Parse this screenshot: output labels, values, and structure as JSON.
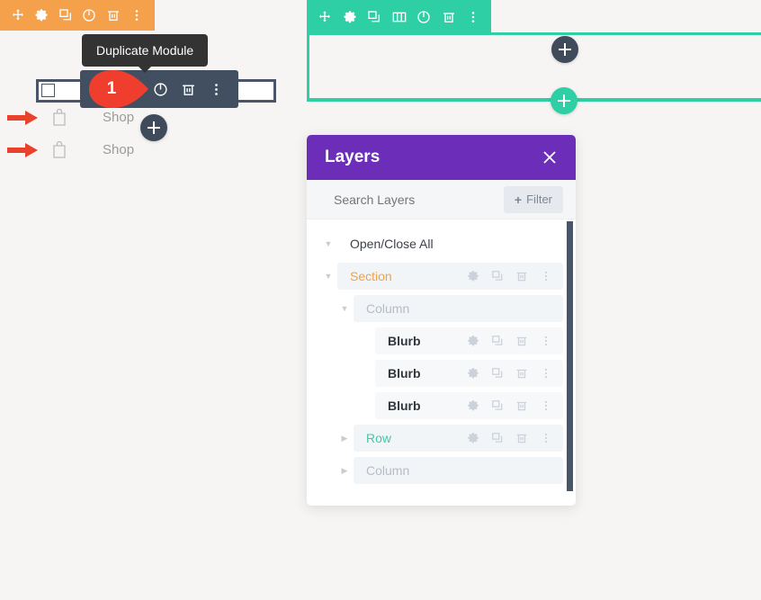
{
  "colors": {
    "canvas": "#f7f5f3",
    "module_toolbar_orange": "#f5a04a",
    "section_toolbar_green": "#2ecfa5",
    "hover_toolbar_dark": "#424f61",
    "tooltip_dark": "#333333",
    "marker_red": "#ef3d2e",
    "layers_header_purple": "#6c2eb9",
    "section_label_orange": "#f0a14a",
    "row_label_green": "#41c9a8",
    "arrow_red": "#e8412c"
  },
  "module_toolbar": {
    "name": "module-settings-toolbar",
    "buttons": [
      {
        "icon": "move-icon",
        "label": "Move"
      },
      {
        "icon": "gear-icon",
        "label": "Settings"
      },
      {
        "icon": "duplicate-icon",
        "label": "Duplicate"
      },
      {
        "icon": "power-icon",
        "label": "Disable"
      },
      {
        "icon": "trash-icon",
        "label": "Delete"
      },
      {
        "icon": "vertical-dots-icon",
        "label": "More Options"
      }
    ]
  },
  "section_toolbar": {
    "name": "section-settings-toolbar",
    "buttons": [
      {
        "icon": "move-icon",
        "label": "Move Section"
      },
      {
        "icon": "gear-icon",
        "label": "Section Settings"
      },
      {
        "icon": "duplicate-icon",
        "label": "Duplicate Section"
      },
      {
        "icon": "columns-icon",
        "label": "Change Column Structure"
      },
      {
        "icon": "power-icon",
        "label": "Disable Section"
      },
      {
        "icon": "trash-icon",
        "label": "Delete Section"
      },
      {
        "icon": "vertical-dots-icon",
        "label": "More Section Options"
      }
    ]
  },
  "hover_toolbar": {
    "name": "module-hover-toolbar",
    "buttons": [
      {
        "icon": "duplicate-icon",
        "label": "Duplicate Module"
      },
      {
        "icon": "power-icon",
        "label": "Disable Module"
      },
      {
        "icon": "trash-icon",
        "label": "Delete Module"
      },
      {
        "icon": "vertical-dots-icon",
        "label": "More Module Options"
      }
    ]
  },
  "tooltip": {
    "text": "Duplicate Module"
  },
  "marker": {
    "number": "1"
  },
  "annotations": [
    {
      "arrow": "arrow-right-icon",
      "icon": "shopping-bag-icon",
      "label": "Shop"
    },
    {
      "arrow": "arrow-right-icon",
      "icon": "shopping-bag-icon",
      "label": "Shop"
    }
  ],
  "add_buttons": [
    {
      "name": "add-module-button",
      "glyph": "+",
      "style": "dark"
    },
    {
      "name": "add-row-button",
      "glyph": "+",
      "style": "dark"
    },
    {
      "name": "add-section-button",
      "glyph": "+",
      "style": "green"
    }
  ],
  "layers_panel": {
    "title": "Layers",
    "close_icon": "close-icon",
    "search": {
      "placeholder": "Search Layers",
      "value": ""
    },
    "filter_button": {
      "plus": "+",
      "label": "Filter"
    },
    "rows": [
      {
        "label": "Open/Close All",
        "tone": "head",
        "indent": 0,
        "caret": "down",
        "actions": []
      },
      {
        "label": "Section",
        "tone": "section",
        "indent": 0,
        "caret": "down",
        "actions": [
          "gear-icon",
          "duplicate-icon",
          "trash-icon",
          "vertical-dots-icon"
        ]
      },
      {
        "label": "Column",
        "tone": "column",
        "indent": 1,
        "caret": "down",
        "actions": []
      },
      {
        "label": "Blurb",
        "tone": "module",
        "indent": 2,
        "caret": "none",
        "actions": [
          "gear-icon",
          "duplicate-icon",
          "trash-icon",
          "vertical-dots-icon"
        ]
      },
      {
        "label": "Blurb",
        "tone": "module",
        "indent": 2,
        "caret": "none",
        "actions": [
          "gear-icon",
          "duplicate-icon",
          "trash-icon",
          "vertical-dots-icon"
        ]
      },
      {
        "label": "Blurb",
        "tone": "module",
        "indent": 2,
        "caret": "none",
        "actions": [
          "gear-icon",
          "duplicate-icon",
          "trash-icon",
          "vertical-dots-icon"
        ]
      },
      {
        "label": "Row",
        "tone": "row",
        "indent": 1,
        "caret": "right",
        "actions": [
          "gear-icon",
          "duplicate-icon",
          "trash-icon",
          "vertical-dots-icon"
        ]
      },
      {
        "label": "Column",
        "tone": "column",
        "indent": 1,
        "caret": "right",
        "actions": []
      }
    ]
  }
}
